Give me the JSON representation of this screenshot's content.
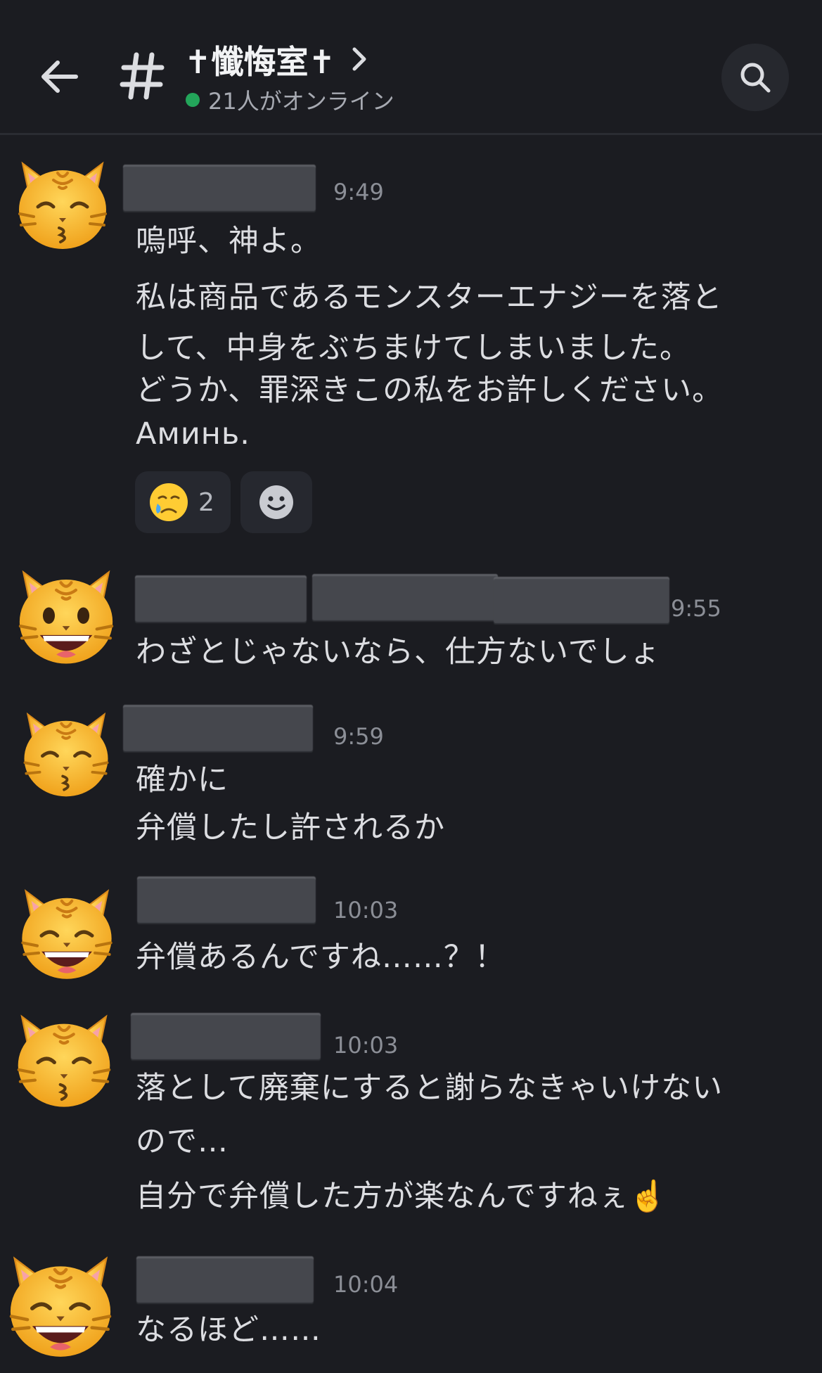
{
  "header": {
    "channel_name": "✝懺悔室✝",
    "online_status": "21人がオンライン"
  },
  "messages": [
    {
      "time": "9:49",
      "lines": [
        "嗚呼、神よ。",
        "私は商品であるモンスターエナジーを落と",
        "して、中身をぶちまけてしまいました。",
        "どうか、罪深きこの私をお許しください。",
        "Аминь."
      ],
      "reactions": [
        {
          "emoji": "😢",
          "count": "2"
        }
      ]
    },
    {
      "time": "9:55",
      "lines": [
        "わざとじゃないなら、仕方ないでしょ"
      ]
    },
    {
      "time": "9:59",
      "lines": [
        "確かに",
        "弁償したし許されるか"
      ]
    },
    {
      "time": "10:03",
      "lines": [
        "弁償あるんですね……？！"
      ]
    },
    {
      "time": "10:03",
      "lines": [
        "落として廃棄にすると謝らなきゃいけない",
        "ので…",
        "自分で弁償した方が楽なんですねぇ☝️"
      ]
    },
    {
      "time": "10:04",
      "lines": [
        "なるほど……"
      ]
    }
  ],
  "colors": {
    "background": "#1b1c21",
    "online": "#23a55a",
    "cat_face": "#f5b62a"
  },
  "icons": [
    "back-arrow-icon",
    "hash-icon",
    "chevron-right-icon",
    "search-icon",
    "add-reaction-icon",
    "kissing-cat-icon",
    "grinning-cat-icon",
    "laughing-cat-icon"
  ]
}
